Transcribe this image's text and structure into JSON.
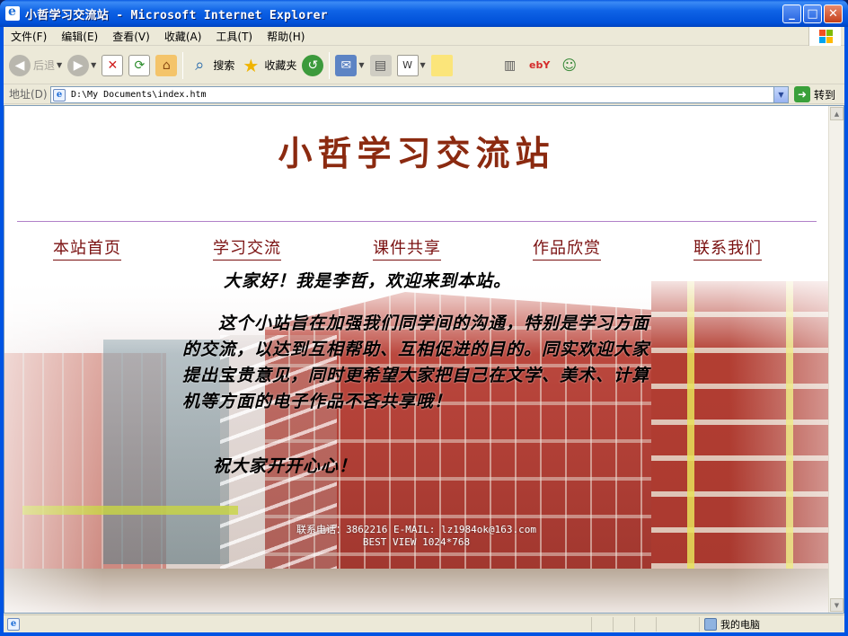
{
  "window": {
    "title": "小哲学习交流站 - Microsoft Internet Explorer",
    "buttons": {
      "minimize": "_",
      "maximize": "□",
      "close": "✕"
    }
  },
  "menu": {
    "items": [
      {
        "label": "文件(F)"
      },
      {
        "label": "编辑(E)"
      },
      {
        "label": "查看(V)"
      },
      {
        "label": "收藏(A)"
      },
      {
        "label": "工具(T)"
      },
      {
        "label": "帮助(H)"
      }
    ]
  },
  "toolbar": {
    "back_label": "后退",
    "search_label": "搜索",
    "favorites_label": "收藏夹"
  },
  "address": {
    "label": "地址(D)",
    "value": "D:\\My Documents\\index.htm",
    "go_label": "转到"
  },
  "page": {
    "site_title": "小哲学习交流站",
    "nav": [
      {
        "label": "本站首页"
      },
      {
        "label": "学习交流"
      },
      {
        "label": "课件共享"
      },
      {
        "label": "作品欣赏"
      },
      {
        "label": "联系我们"
      }
    ],
    "greeting": "大家好！我是李哲，欢迎来到本站。",
    "body": "这个小站旨在加强我们同学间的沟通，特别是学习方面的交流，以达到互相帮助、互相促进的目的。同实欢迎大家提出宝贵意见，同时更希望大家把自己在文学、美术、计算机等方面的电子作品不吝共享哦！",
    "wish": "祝大家开开心心！",
    "contact_line1": "联系电话：3862216 E-MAIL: lz1984ok@163.com",
    "contact_line2": "BEST VIEW 1024*768"
  },
  "status": {
    "zone_label": "我的电脑"
  },
  "colors": {
    "title_red": "#8b2a10",
    "nav_red": "#7a1010",
    "xp_blue": "#0054e3"
  }
}
